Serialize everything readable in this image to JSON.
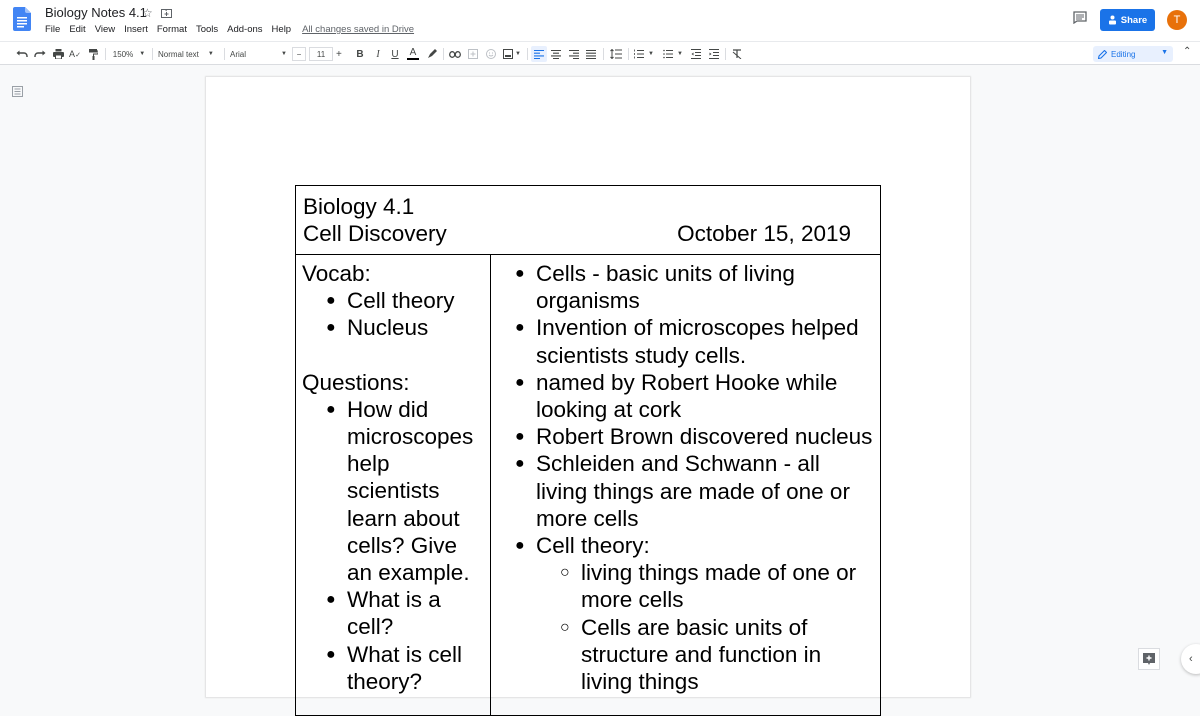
{
  "app": {
    "title": "Biology Notes 4.1",
    "saved_status": "All changes saved in Drive",
    "menu": [
      "File",
      "Edit",
      "View",
      "Insert",
      "Format",
      "Tools",
      "Add-ons",
      "Help"
    ],
    "share_label": "Share",
    "avatar_initial": "T",
    "brand_color": "#1a73e8",
    "avatar_color": "#e8710a"
  },
  "toolbar": {
    "zoom": "150%",
    "style": "Normal text",
    "font": "Arial",
    "font_size": "11",
    "minus": "−",
    "plus": "+",
    "bold": "B",
    "italic": "I",
    "underline": "U",
    "text_color": "A",
    "mode": "Editing"
  },
  "document": {
    "header": {
      "line1": "Biology 4.1",
      "line2": "Cell Discovery",
      "date": "October 15, 2019"
    },
    "left": {
      "vocab_heading": "Vocab:",
      "vocab": [
        "Cell theory",
        "Nucleus"
      ],
      "questions_heading": "Questions:",
      "questions": [
        "How did microscopes help scientists learn about cells? Give an example.",
        "What is a cell?",
        "What is cell theory?"
      ]
    },
    "right": {
      "notes": [
        "Cells - basic units of living organisms",
        "Invention of microscopes helped scientists study cells.",
        "named by Robert Hooke while looking at cork",
        "Robert Brown discovered nucleus",
        "Schleiden and Schwann - all living things are made of one or more cells",
        "Cell theory:"
      ],
      "cell_theory": [
        "living things made of one or more cells",
        "Cells are basic units of structure and function in living things"
      ]
    }
  }
}
